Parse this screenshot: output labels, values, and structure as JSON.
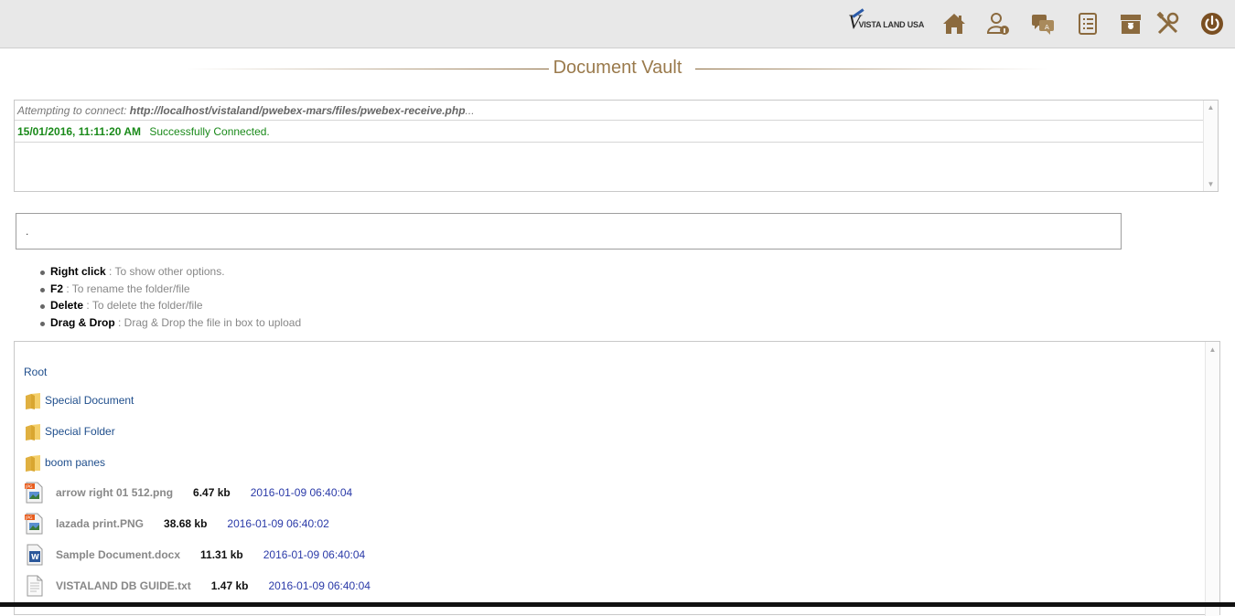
{
  "header": {
    "logo_text": "VISTA LAND USA",
    "logo_letter": "V",
    "nav_icons": [
      "home-icon",
      "user-info-icon",
      "messages-icon",
      "list-icon",
      "archive-icon",
      "tools-icon",
      "power-icon"
    ]
  },
  "page": {
    "title": "Document Vault"
  },
  "console": {
    "connect_prefix": "Attempting to connect:",
    "connect_url": "http://localhost/vistaland/pwebex-mars/files/pwebex-receive.php",
    "connect_suffix": "...",
    "status_timestamp": "15/01/2016, 11:11:20 AM",
    "status_message": "Successfully Connected."
  },
  "path_box": {
    "value": "."
  },
  "tips": [
    {
      "key": "Right click",
      "desc": " : To show other options."
    },
    {
      "key": "F2",
      "desc": " : To rename the folder/file"
    },
    {
      "key": "Delete",
      "desc": " : To delete the folder/file"
    },
    {
      "key": "Drag & Drop",
      "desc": " : Drag & Drop the file in box to upload"
    }
  ],
  "explorer": {
    "root_label": "Root",
    "folders": [
      {
        "name": "Special Document"
      },
      {
        "name": "Special Folder"
      },
      {
        "name": "boom panes"
      }
    ],
    "files": [
      {
        "name": "arrow right 01 512.png",
        "size": "6.47 kb",
        "date": "2016-01-09 06:40:04",
        "icon": "image-file-icon"
      },
      {
        "name": "lazada print.PNG",
        "size": "38.68 kb",
        "date": "2016-01-09 06:40:02",
        "icon": "image-file-icon"
      },
      {
        "name": "Sample Document.docx",
        "size": "11.31 kb",
        "date": "2016-01-09 06:40:04",
        "icon": "word-file-icon"
      },
      {
        "name": "VISTALAND DB GUIDE.txt",
        "size": "1.47 kb",
        "date": "2016-01-09 06:40:04",
        "icon": "text-file-icon"
      }
    ]
  },
  "colors": {
    "accent": "#8b6a3e",
    "link": "#1f4e8c",
    "success": "#1a8a1a",
    "date": "#2a3aa8"
  }
}
